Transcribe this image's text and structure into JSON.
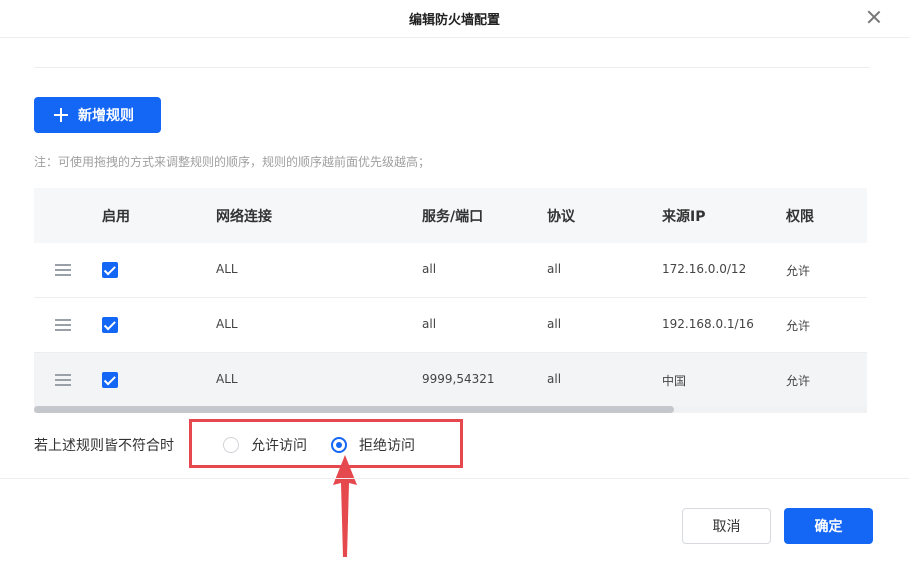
{
  "dialog": {
    "title": "编辑防火墙配置",
    "close_icon": "close-icon"
  },
  "toolbar": {
    "add_label": "新增规则",
    "add_icon": "plus-icon"
  },
  "note": "注：可使用拖拽的方式来调整规则的顺序，规则的顺序越前面优先级越高；",
  "table": {
    "columns": [
      "启用",
      "网络连接",
      "服务/端口",
      "协议",
      "来源IP",
      "权限"
    ],
    "rows": [
      {
        "enabled": true,
        "network": "ALL",
        "service": "all",
        "protocol": "all",
        "source_ip": "172.16.0.0/12",
        "permission": "允许"
      },
      {
        "enabled": true,
        "network": "ALL",
        "service": "all",
        "protocol": "all",
        "source_ip": "192.168.0.1/16",
        "permission": "允许"
      },
      {
        "enabled": true,
        "network": "ALL",
        "service": "9999,54321",
        "protocol": "all",
        "source_ip": "中国",
        "permission": "允许"
      }
    ]
  },
  "fallback": {
    "label": "若上述规则皆不符合时",
    "options": [
      {
        "label": "允许访问",
        "selected": false
      },
      {
        "label": "拒绝访问",
        "selected": true
      }
    ]
  },
  "footer": {
    "cancel_label": "取消",
    "ok_label": "确定"
  },
  "colors": {
    "primary": "#1466f5",
    "annotation": "#e5484d"
  }
}
